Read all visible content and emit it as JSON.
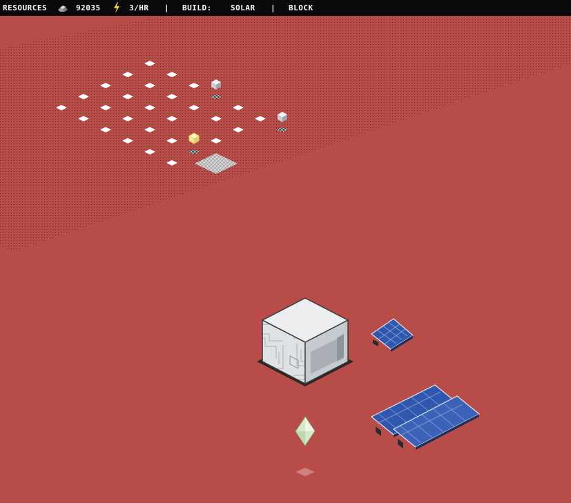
{
  "hud": {
    "resources_label": "RESOURCES",
    "resources_value": "92035",
    "power_rate": "3/HR",
    "separator": "|",
    "build_label": "BUILD:",
    "build_option_1": "SOLAR",
    "build_option_2": "BLOCK"
  },
  "icons": {
    "resources": "rock-pile-icon",
    "power": "lightning-bolt-icon"
  },
  "colors": {
    "terrain": "#b84c48",
    "hud_background": "#0a0a0a",
    "hud_text": "#ffffff",
    "power_icon": "#f2d21b",
    "solar_panel": "#3a63b8",
    "block_face_top": "#eceef0",
    "crystal": "#d5e9c6",
    "tile_marker": "#ffffff"
  }
}
